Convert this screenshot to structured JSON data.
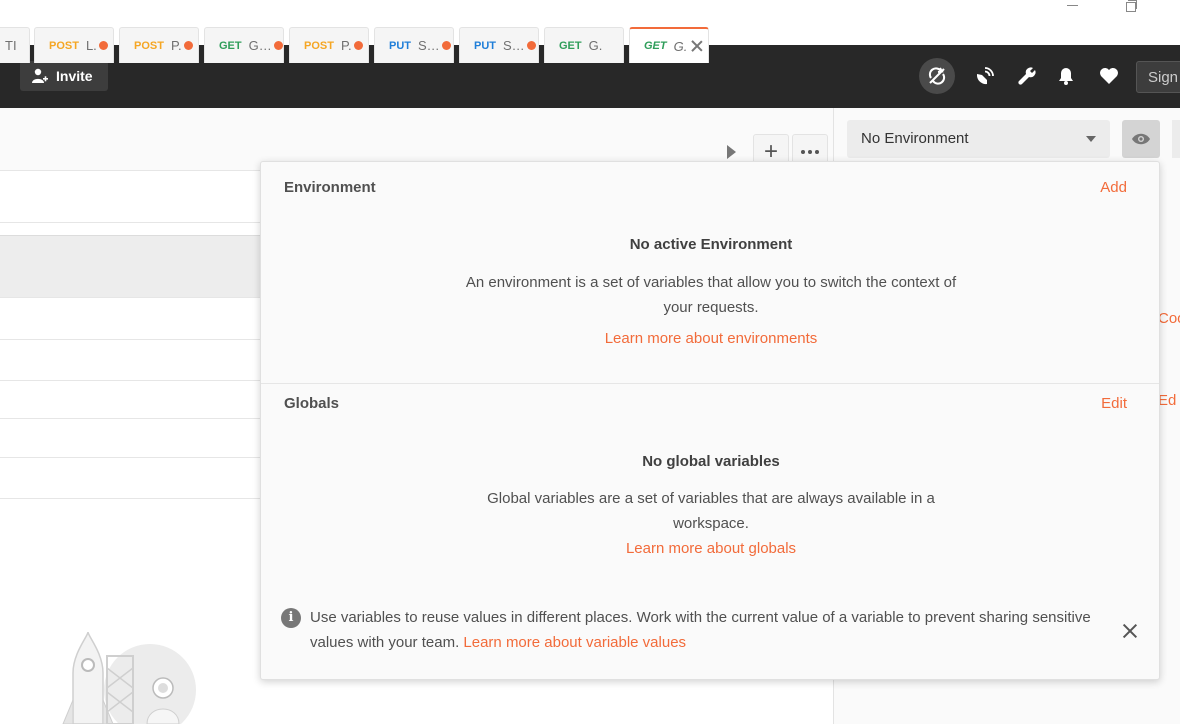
{
  "header": {
    "invite_label": "Invite",
    "signin_label": "Sign In"
  },
  "tabs": [
    {
      "method": "",
      "name": "TI",
      "dirty": false
    },
    {
      "method": "POST",
      "name": "L.",
      "dirty": true
    },
    {
      "method": "POST",
      "name": "P.",
      "dirty": true
    },
    {
      "method": "GET",
      "name": "G…",
      "dirty": true
    },
    {
      "method": "POST",
      "name": "P.",
      "dirty": true
    },
    {
      "method": "PUT",
      "name": "S…",
      "dirty": true
    },
    {
      "method": "PUT",
      "name": "S…",
      "dirty": true
    },
    {
      "method": "GET",
      "name": "G.",
      "dirty": false
    },
    {
      "method": "GET",
      "name": "G.",
      "dirty": false,
      "active": true
    }
  ],
  "env_selector": {
    "selected": "No Environment"
  },
  "background": {
    "right_text_1": "Coo",
    "right_text_2": "Ed"
  },
  "popover": {
    "environment": {
      "title": "Environment",
      "action": "Add",
      "empty_title": "No active Environment",
      "description": "An environment is a set of variables that allow you to switch the context of your requests.",
      "link": "Learn more about environments"
    },
    "globals": {
      "title": "Globals",
      "action": "Edit",
      "empty_title": "No global variables",
      "description": "Global variables are a set of variables that are always available in a workspace.",
      "link": "Learn more about globals"
    },
    "info": {
      "text": "Use variables to reuse values in different places. Work with the current value of a variable to prevent sharing sensitive values with your team.",
      "link": "Learn more about variable values"
    }
  },
  "colors": {
    "accent": "#f26b3a",
    "header_bg": "#282828",
    "post": "#f5a623",
    "get": "#2f9e5a",
    "put": "#1f7ed8"
  }
}
